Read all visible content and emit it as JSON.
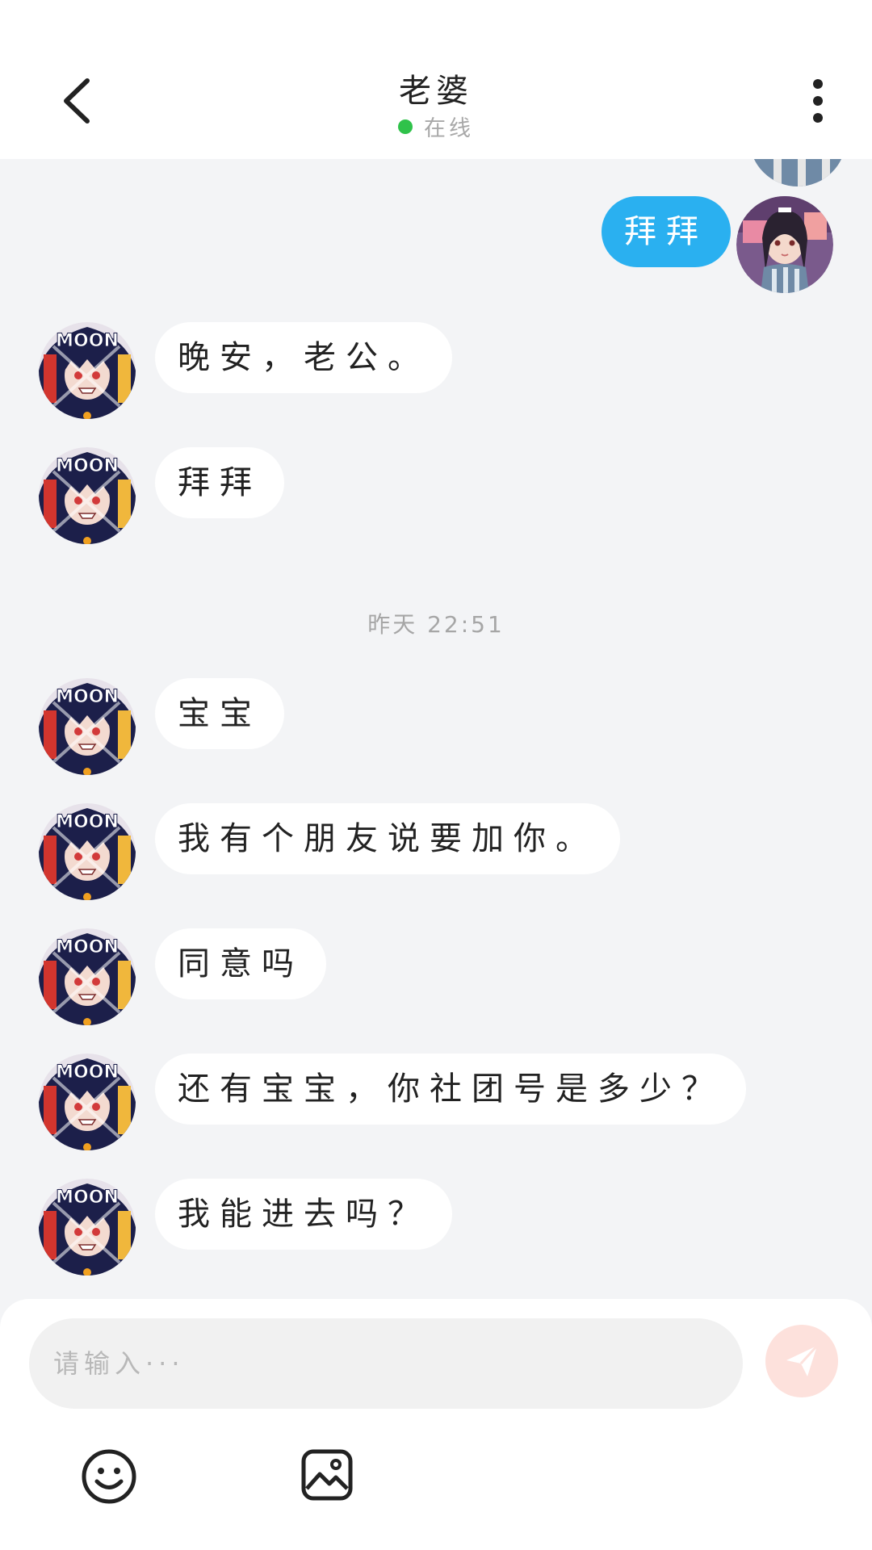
{
  "header": {
    "title": "老婆",
    "status": "在线"
  },
  "messages": [
    {
      "side": "out",
      "text": "拜拜"
    },
    {
      "side": "in",
      "text": "晚安，老公。"
    },
    {
      "side": "in",
      "text": "拜拜"
    },
    {
      "side": "in",
      "text": "宝宝"
    },
    {
      "side": "in",
      "text": "我有个朋友说要加你。"
    },
    {
      "side": "in",
      "text": "同意吗"
    },
    {
      "side": "in",
      "text": "还有宝宝，你社团号是多少？"
    },
    {
      "side": "in",
      "text": "我能进去吗？"
    }
  ],
  "time_separator": "昨天 22:51",
  "composer": {
    "placeholder": "请输入···"
  },
  "colors": {
    "accent": "#2ab0f0",
    "online": "#2fc24a",
    "send_button": "#fde1dc"
  },
  "icons": {
    "back": "chevron-left-icon",
    "more": "more-vertical-icon",
    "send": "paper-plane-icon",
    "emoji": "smiley-icon",
    "image": "image-icon"
  }
}
